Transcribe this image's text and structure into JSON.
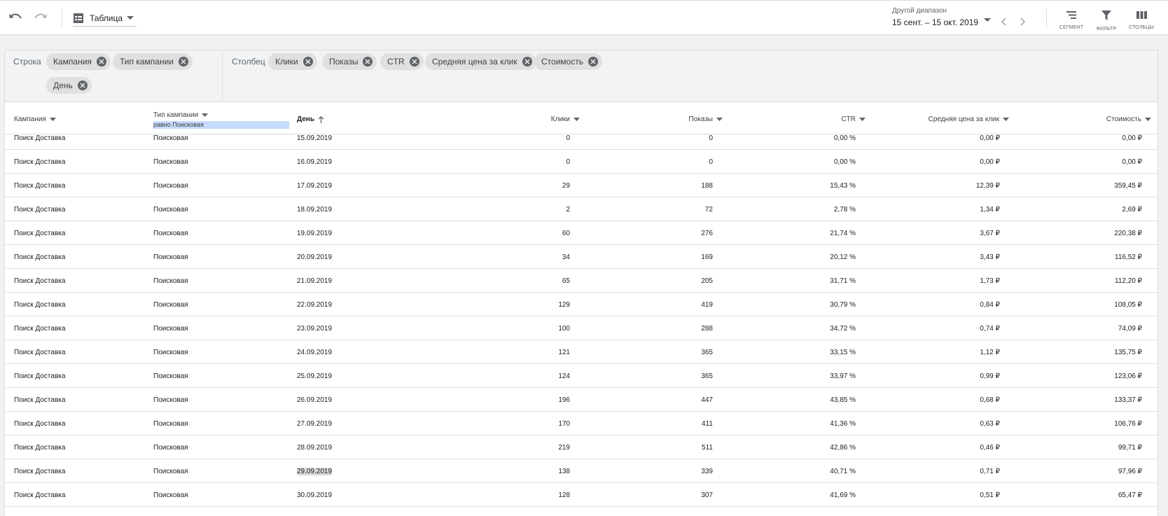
{
  "toolbar": {
    "view_label": "Таблица",
    "date_range_label": "Другой диапазон",
    "date_range_value": "15 сент. – 15 окт. 2019",
    "tools": [
      {
        "label": "СЕГМЕНТ",
        "icon": "segment-icon"
      },
      {
        "label": "ФИЛЬТР",
        "icon": "filter-icon"
      },
      {
        "label": "СТОЛБЦЫ",
        "icon": "columns-icon"
      }
    ]
  },
  "pivot": {
    "rows_label": "Строка",
    "row_chips": [
      "Кампания",
      "Тип кампании",
      "День"
    ],
    "columns_label": "Столбец",
    "column_chips": [
      "Клики",
      "Показы",
      "CTR",
      "Средняя цена за клик",
      "Стоимость"
    ]
  },
  "table": {
    "headers": {
      "campaign": "Кампания",
      "type": "Тип кампании",
      "day": "День",
      "clicks": "Клики",
      "impressions": "Показы",
      "ctr": "CTR",
      "avg_cpc": "Средняя цена за клик",
      "cost": "Стоимость"
    },
    "type_filter_hint": "равно Поисковая",
    "rows": [
      {
        "campaign": "Поиск Доставка",
        "type": "Поисковая",
        "day": "15.09.2019",
        "clicks": "0",
        "impressions": "0",
        "ctr": "0,00 %",
        "avg_cpc": "0,00 ₽",
        "cost": "0,00 ₽"
      },
      {
        "campaign": "Поиск Доставка",
        "type": "Поисковая",
        "day": "16.09.2019",
        "clicks": "0",
        "impressions": "0",
        "ctr": "0,00 %",
        "avg_cpc": "0,00 ₽",
        "cost": "0,00 ₽"
      },
      {
        "campaign": "Поиск Доставка",
        "type": "Поисковая",
        "day": "17.09.2019",
        "clicks": "29",
        "impressions": "188",
        "ctr": "15,43 %",
        "avg_cpc": "12,39 ₽",
        "cost": "359,45 ₽"
      },
      {
        "campaign": "Поиск Доставка",
        "type": "Поисковая",
        "day": "18.09.2019",
        "clicks": "2",
        "impressions": "72",
        "ctr": "2,78 %",
        "avg_cpc": "1,34 ₽",
        "cost": "2,69 ₽"
      },
      {
        "campaign": "Поиск Доставка",
        "type": "Поисковая",
        "day": "19.09.2019",
        "clicks": "60",
        "impressions": "276",
        "ctr": "21,74 %",
        "avg_cpc": "3,67 ₽",
        "cost": "220,38 ₽"
      },
      {
        "campaign": "Поиск Доставка",
        "type": "Поисковая",
        "day": "20.09.2019",
        "clicks": "34",
        "impressions": "169",
        "ctr": "20,12 %",
        "avg_cpc": "3,43 ₽",
        "cost": "116,52 ₽"
      },
      {
        "campaign": "Поиск Доставка",
        "type": "Поисковая",
        "day": "21.09.2019",
        "clicks": "65",
        "impressions": "205",
        "ctr": "31,71 %",
        "avg_cpc": "1,73 ₽",
        "cost": "112,20 ₽"
      },
      {
        "campaign": "Поиск Доставка",
        "type": "Поисковая",
        "day": "22.09.2019",
        "clicks": "129",
        "impressions": "419",
        "ctr": "30,79 %",
        "avg_cpc": "0,84 ₽",
        "cost": "108,05 ₽"
      },
      {
        "campaign": "Поиск Доставка",
        "type": "Поисковая",
        "day": "23.09.2019",
        "clicks": "100",
        "impressions": "288",
        "ctr": "34,72 %",
        "avg_cpc": "0,74 ₽",
        "cost": "74,09 ₽"
      },
      {
        "campaign": "Поиск Доставка",
        "type": "Поисковая",
        "day": "24.09.2019",
        "clicks": "121",
        "impressions": "365",
        "ctr": "33,15 %",
        "avg_cpc": "1,12 ₽",
        "cost": "135,75 ₽"
      },
      {
        "campaign": "Поиск Доставка",
        "type": "Поисковая",
        "day": "25.09.2019",
        "clicks": "124",
        "impressions": "365",
        "ctr": "33,97 %",
        "avg_cpc": "0,99 ₽",
        "cost": "123,06 ₽"
      },
      {
        "campaign": "Поиск Доставка",
        "type": "Поисковая",
        "day": "26.09.2019",
        "clicks": "196",
        "impressions": "447",
        "ctr": "43,85 %",
        "avg_cpc": "0,68 ₽",
        "cost": "133,37 ₽"
      },
      {
        "campaign": "Поиск Доставка",
        "type": "Поисковая",
        "day": "27.09.2019",
        "clicks": "170",
        "impressions": "411",
        "ctr": "41,36 %",
        "avg_cpc": "0,63 ₽",
        "cost": "106,76 ₽"
      },
      {
        "campaign": "Поиск Доставка",
        "type": "Поисковая",
        "day": "28.09.2019",
        "clicks": "219",
        "impressions": "511",
        "ctr": "42,86 %",
        "avg_cpc": "0,46 ₽",
        "cost": "99,71 ₽"
      },
      {
        "campaign": "Поиск Доставка",
        "type": "Поисковая",
        "day": "29.09.2019",
        "clicks": "138",
        "impressions": "339",
        "ctr": "40,71 %",
        "avg_cpc": "0,71 ₽",
        "cost": "97,96 ₽"
      },
      {
        "campaign": "Поиск Доставка",
        "type": "Поисковая",
        "day": "30.09.2019",
        "clicks": "128",
        "impressions": "307",
        "ctr": "41,69 %",
        "avg_cpc": "0,51 ₽",
        "cost": "65,47 ₽"
      }
    ]
  }
}
